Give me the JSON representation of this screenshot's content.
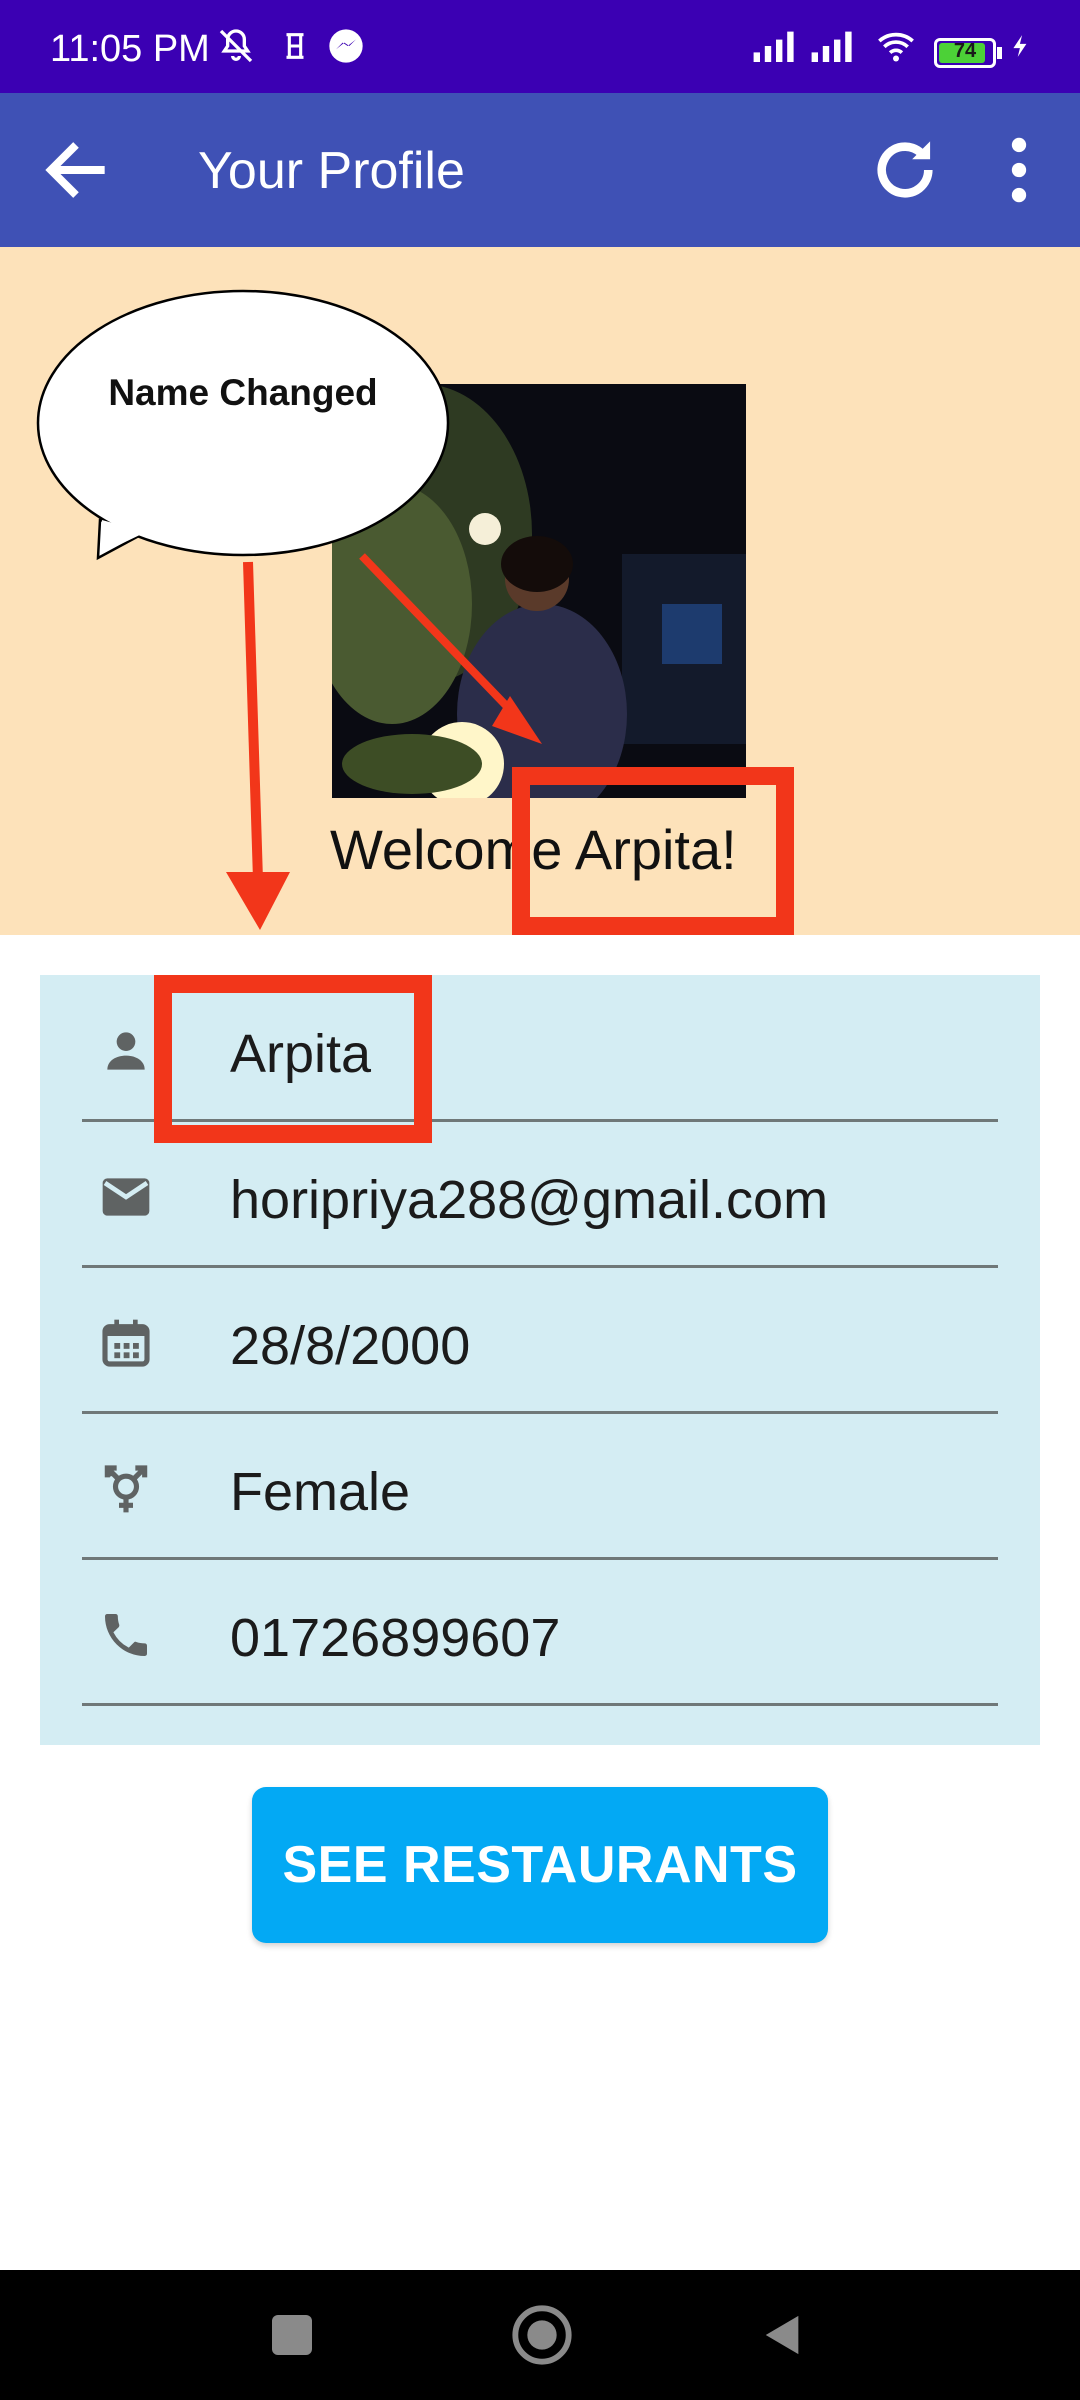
{
  "status_bar": {
    "time": "11:05 PM",
    "battery": "74"
  },
  "app_bar": {
    "title": "Your Profile"
  },
  "header": {
    "welcome": "Welcome Arpita!"
  },
  "annotation": {
    "callout": "Name Changed"
  },
  "profile": {
    "name": "Arpita",
    "email": "horipriya288@gmail.com",
    "dob": "28/8/2000",
    "gender": "Female",
    "phone": "01726899607"
  },
  "actions": {
    "see_restaurants": "SEE RESTAURANTS"
  },
  "colors": {
    "status_bar": "#3b00b3",
    "app_bar": "#3f51b5",
    "header_bg": "#fde2ba",
    "card_bg": "#d4edf3",
    "button": "#03a9f4",
    "annotation_red": "#f2361a"
  }
}
